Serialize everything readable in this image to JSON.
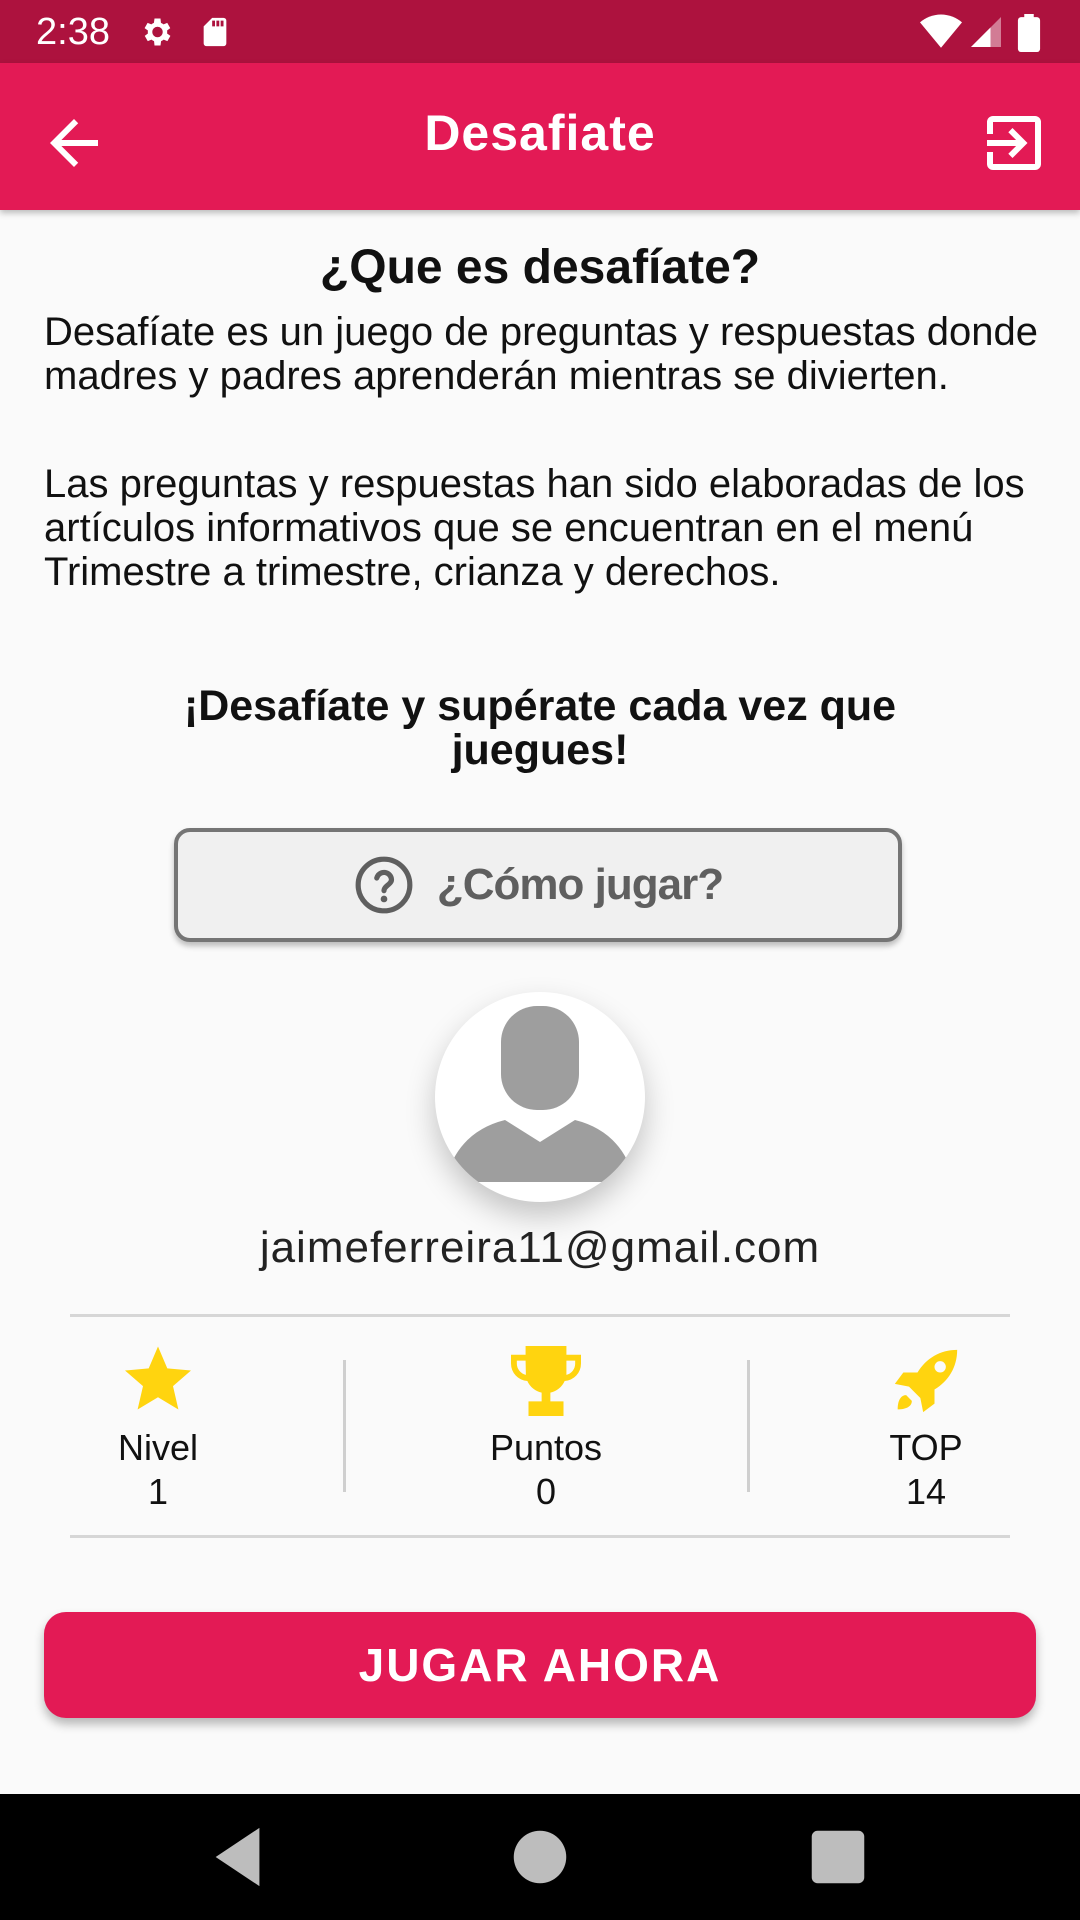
{
  "status_bar": {
    "time": "2:38",
    "icons": [
      "gear-icon",
      "sd-card-icon",
      "wifi-icon",
      "signal-icon",
      "battery-icon"
    ]
  },
  "app_bar": {
    "title": "Desafiate",
    "back_icon": "arrow-back-icon",
    "exit_icon": "exit-to-app-icon"
  },
  "main": {
    "heading": "¿Que es desafíate?",
    "paragraph1": "Desafíate es un juego de preguntas y respuestas  donde madres y padres aprenderán mientras se divierten.",
    "paragraph2": "Las preguntas y respuestas han sido elaboradas de los artículos informativos que se encuentran en el menú Trimestre a trimestre, crianza y derechos.",
    "tagline": "¡Desafíate y supérate cada vez que juegues!",
    "how_to_button": {
      "label": "¿Cómo jugar?",
      "icon": "help-circle-icon"
    }
  },
  "profile": {
    "avatar_icon": "person-icon",
    "email": "jaimeferreira11@gmail.com"
  },
  "stats": [
    {
      "icon": "star-icon",
      "label": "Nivel",
      "value": "1"
    },
    {
      "icon": "trophy-icon",
      "label": "Puntos",
      "value": "0"
    },
    {
      "icon": "rocket-icon",
      "label": "TOP",
      "value": "14"
    }
  ],
  "play_button": {
    "label": "JUGAR AHORA"
  },
  "nav_bar": {
    "icons": [
      "back-triangle-icon",
      "home-circle-icon",
      "recents-square-icon"
    ]
  },
  "colors": {
    "status_bar": "#ad123e",
    "primary": "#e31a55",
    "icon_yellow": "#ffd40f",
    "background": "#fafafa"
  }
}
